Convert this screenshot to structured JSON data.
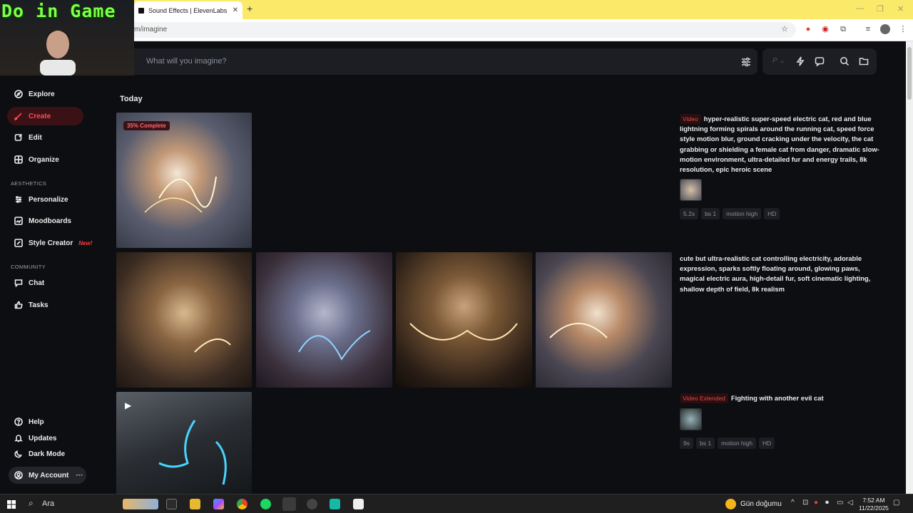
{
  "browser": {
    "tab_title": "Sound Effects | ElevenLabs",
    "url": "m/imagine"
  },
  "overlay": {
    "banner": "Do in Game"
  },
  "search": {
    "placeholder": "What will you imagine?"
  },
  "sidebar": {
    "items": [
      {
        "label": "Explore"
      },
      {
        "label": "Create"
      },
      {
        "label": "Edit"
      },
      {
        "label": "Organize"
      },
      {
        "label": "Personalize"
      },
      {
        "label": "Moodboards"
      },
      {
        "label": "Style Creator",
        "badge": "New!"
      },
      {
        "label": "Chat"
      },
      {
        "label": "Tasks"
      }
    ],
    "sections": {
      "aesthetics": "AESTHETICS",
      "community": "COMMUNITY"
    },
    "bottom": [
      {
        "label": "Help"
      },
      {
        "label": "Updates"
      },
      {
        "label": "Dark Mode"
      }
    ],
    "account": {
      "label": "My Account",
      "dots": "···"
    }
  },
  "feed": {
    "heading": "Today",
    "jobs": [
      {
        "badge": "35% Complete",
        "tag": "Video",
        "prompt": "hyper-realistic super-speed electric cat, red and blue lightning forming spirals around the running cat, speed force style motion blur, ground cracking under the velocity, the cat grabbing or shielding a female cat from danger, dramatic slow-motion environment, ultra-detailed fur and energy trails, 8k resolution, epic heroic scene",
        "chips": [
          "5.2s",
          "bs 1",
          "motion high",
          "HD"
        ]
      },
      {
        "prompt": "cute but ultra-realistic cat controlling electricity, adorable expression, sparks softly floating around, glowing paws, magical electric aura, high-detail fur, soft cinematic lighting, shallow depth of field, 8k realism"
      },
      {
        "tag": "Video Extended",
        "prompt": "Fighting with another evil cat",
        "chips": [
          "9s",
          "bs 1",
          "motion high",
          "HD"
        ]
      }
    ]
  },
  "taskbar": {
    "search_label": "Ara",
    "weather": "Gün doğumu",
    "time": "7:52 AM",
    "date": "11/22/2025"
  },
  "colors": {
    "accent": "#ff4a55",
    "background": "#0d0e11",
    "tab_bar": "#fbe96a"
  }
}
